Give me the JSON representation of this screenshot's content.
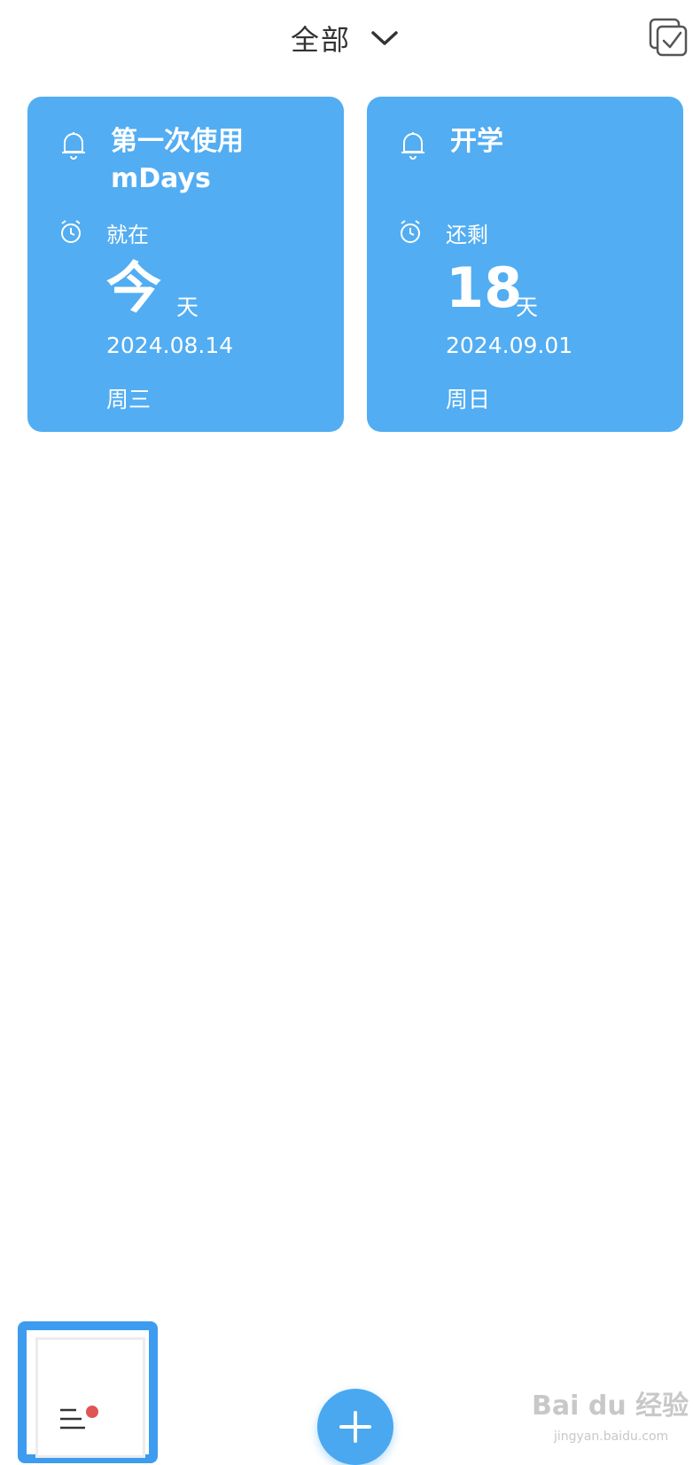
{
  "header": {
    "filter_label": "全部"
  },
  "cards": [
    {
      "title": "第一次使用\nmDays",
      "status": "就在",
      "number": "今",
      "unit": "天",
      "date": "2024.08.14",
      "weekday": "周三"
    },
    {
      "title": "开学",
      "status": "还剩",
      "number": "18",
      "unit": "天",
      "date": "2024.09.01",
      "weekday": "周日"
    }
  ],
  "watermark": {
    "brand": "Bai du 经验",
    "url": "jingyan.baidu.com"
  },
  "colors": {
    "card": "#52adf2",
    "accent": "#4aa8f0",
    "highlight": "#3d9cf0",
    "dot": "#e05555"
  }
}
